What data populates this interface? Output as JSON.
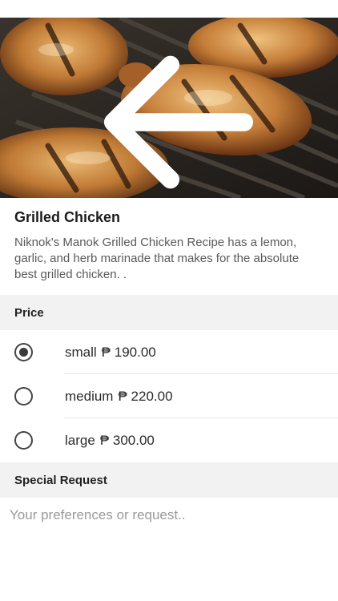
{
  "header": {
    "back_icon": "arrow-left-icon"
  },
  "item": {
    "title": "Grilled Chicken",
    "description": "Niknok's Manok Grilled Chicken Recipe has a lemon, garlic, and herb marinade that makes for the absolute best grilled chicken. ."
  },
  "price_section": {
    "title": "Price",
    "currency_symbol": "₱",
    "options": [
      {
        "size": "small",
        "price": "₱ 190.00",
        "selected": true
      },
      {
        "size": "medium",
        "price": "₱ 220.00",
        "selected": false
      },
      {
        "size": "large",
        "price": "₱ 300.00",
        "selected": false
      }
    ]
  },
  "special_request": {
    "title": "Special Request",
    "placeholder": "Your preferences or request..",
    "value": ""
  },
  "colors": {
    "section_bg": "#f2f2f2",
    "radio": "#3a3a3a",
    "description": "#5a5a5a"
  }
}
